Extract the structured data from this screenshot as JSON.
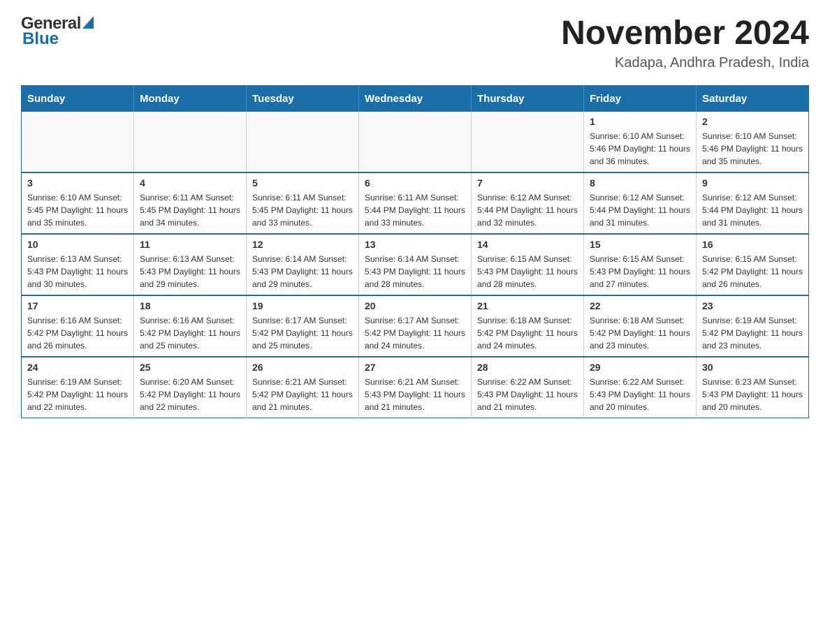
{
  "header": {
    "title": "November 2024",
    "subtitle": "Kadapa, Andhra Pradesh, India",
    "logo_general": "General",
    "logo_blue": "Blue"
  },
  "days_of_week": [
    "Sunday",
    "Monday",
    "Tuesday",
    "Wednesday",
    "Thursday",
    "Friday",
    "Saturday"
  ],
  "weeks": [
    [
      {
        "day": "",
        "info": ""
      },
      {
        "day": "",
        "info": ""
      },
      {
        "day": "",
        "info": ""
      },
      {
        "day": "",
        "info": ""
      },
      {
        "day": "",
        "info": ""
      },
      {
        "day": "1",
        "info": "Sunrise: 6:10 AM\nSunset: 5:46 PM\nDaylight: 11 hours and 36 minutes."
      },
      {
        "day": "2",
        "info": "Sunrise: 6:10 AM\nSunset: 5:46 PM\nDaylight: 11 hours and 35 minutes."
      }
    ],
    [
      {
        "day": "3",
        "info": "Sunrise: 6:10 AM\nSunset: 5:45 PM\nDaylight: 11 hours and 35 minutes."
      },
      {
        "day": "4",
        "info": "Sunrise: 6:11 AM\nSunset: 5:45 PM\nDaylight: 11 hours and 34 minutes."
      },
      {
        "day": "5",
        "info": "Sunrise: 6:11 AM\nSunset: 5:45 PM\nDaylight: 11 hours and 33 minutes."
      },
      {
        "day": "6",
        "info": "Sunrise: 6:11 AM\nSunset: 5:44 PM\nDaylight: 11 hours and 33 minutes."
      },
      {
        "day": "7",
        "info": "Sunrise: 6:12 AM\nSunset: 5:44 PM\nDaylight: 11 hours and 32 minutes."
      },
      {
        "day": "8",
        "info": "Sunrise: 6:12 AM\nSunset: 5:44 PM\nDaylight: 11 hours and 31 minutes."
      },
      {
        "day": "9",
        "info": "Sunrise: 6:12 AM\nSunset: 5:44 PM\nDaylight: 11 hours and 31 minutes."
      }
    ],
    [
      {
        "day": "10",
        "info": "Sunrise: 6:13 AM\nSunset: 5:43 PM\nDaylight: 11 hours and 30 minutes."
      },
      {
        "day": "11",
        "info": "Sunrise: 6:13 AM\nSunset: 5:43 PM\nDaylight: 11 hours and 29 minutes."
      },
      {
        "day": "12",
        "info": "Sunrise: 6:14 AM\nSunset: 5:43 PM\nDaylight: 11 hours and 29 minutes."
      },
      {
        "day": "13",
        "info": "Sunrise: 6:14 AM\nSunset: 5:43 PM\nDaylight: 11 hours and 28 minutes."
      },
      {
        "day": "14",
        "info": "Sunrise: 6:15 AM\nSunset: 5:43 PM\nDaylight: 11 hours and 28 minutes."
      },
      {
        "day": "15",
        "info": "Sunrise: 6:15 AM\nSunset: 5:43 PM\nDaylight: 11 hours and 27 minutes."
      },
      {
        "day": "16",
        "info": "Sunrise: 6:15 AM\nSunset: 5:42 PM\nDaylight: 11 hours and 26 minutes."
      }
    ],
    [
      {
        "day": "17",
        "info": "Sunrise: 6:16 AM\nSunset: 5:42 PM\nDaylight: 11 hours and 26 minutes."
      },
      {
        "day": "18",
        "info": "Sunrise: 6:16 AM\nSunset: 5:42 PM\nDaylight: 11 hours and 25 minutes."
      },
      {
        "day": "19",
        "info": "Sunrise: 6:17 AM\nSunset: 5:42 PM\nDaylight: 11 hours and 25 minutes."
      },
      {
        "day": "20",
        "info": "Sunrise: 6:17 AM\nSunset: 5:42 PM\nDaylight: 11 hours and 24 minutes."
      },
      {
        "day": "21",
        "info": "Sunrise: 6:18 AM\nSunset: 5:42 PM\nDaylight: 11 hours and 24 minutes."
      },
      {
        "day": "22",
        "info": "Sunrise: 6:18 AM\nSunset: 5:42 PM\nDaylight: 11 hours and 23 minutes."
      },
      {
        "day": "23",
        "info": "Sunrise: 6:19 AM\nSunset: 5:42 PM\nDaylight: 11 hours and 23 minutes."
      }
    ],
    [
      {
        "day": "24",
        "info": "Sunrise: 6:19 AM\nSunset: 5:42 PM\nDaylight: 11 hours and 22 minutes."
      },
      {
        "day": "25",
        "info": "Sunrise: 6:20 AM\nSunset: 5:42 PM\nDaylight: 11 hours and 22 minutes."
      },
      {
        "day": "26",
        "info": "Sunrise: 6:21 AM\nSunset: 5:42 PM\nDaylight: 11 hours and 21 minutes."
      },
      {
        "day": "27",
        "info": "Sunrise: 6:21 AM\nSunset: 5:43 PM\nDaylight: 11 hours and 21 minutes."
      },
      {
        "day": "28",
        "info": "Sunrise: 6:22 AM\nSunset: 5:43 PM\nDaylight: 11 hours and 21 minutes."
      },
      {
        "day": "29",
        "info": "Sunrise: 6:22 AM\nSunset: 5:43 PM\nDaylight: 11 hours and 20 minutes."
      },
      {
        "day": "30",
        "info": "Sunrise: 6:23 AM\nSunset: 5:43 PM\nDaylight: 11 hours and 20 minutes."
      }
    ]
  ]
}
